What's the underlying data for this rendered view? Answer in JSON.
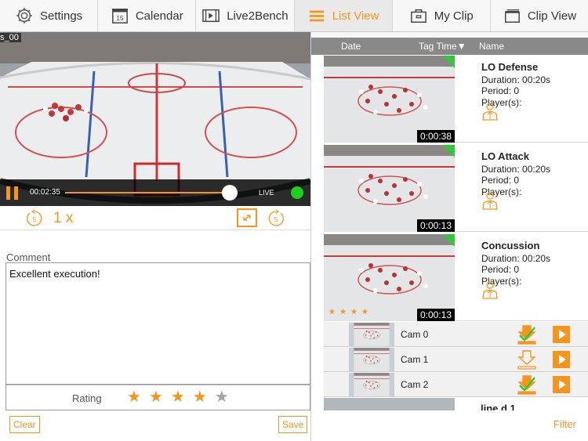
{
  "tabs": [
    {
      "label": "Settings",
      "icon": "gear-icon"
    },
    {
      "label": "Calendar",
      "icon": "calendar-icon",
      "icon_text": "15"
    },
    {
      "label": "Live2Bench",
      "icon": "film-strip-icon"
    },
    {
      "label": "List View",
      "icon": "list-icon",
      "active": true
    },
    {
      "label": "My Clip",
      "icon": "briefcase-icon"
    },
    {
      "label": "Clip View",
      "icon": "stacked-screens-icon"
    }
  ],
  "video": {
    "source_label": "s_00",
    "time": "00:02:35",
    "progress_fraction": 0.955,
    "live_label": "LIVE",
    "live_status_color": "#1ed01e"
  },
  "playback": {
    "rewind_seconds": "5",
    "speed": "1 x",
    "forward_seconds": "5"
  },
  "comment": {
    "label": "Comment",
    "text": "Excellent execution!"
  },
  "rating": {
    "label": "Rating",
    "value": 4,
    "max": 5
  },
  "buttons": {
    "clear": "Clear",
    "save": "Save",
    "filter": "Filter"
  },
  "list_header": {
    "date": "Date",
    "tag_time": "Tag Time",
    "sort_indicator": "▼",
    "name": "Name"
  },
  "clips": [
    {
      "name": "LO Defense",
      "duration": "Duration: 00:20s",
      "period": "Period: 0",
      "players": "Player(s):",
      "timestamp": "0:00:38",
      "stars": 0
    },
    {
      "name": "LO Attack",
      "duration": "Duration: 00:20s",
      "period": "Period: 0",
      "players": "Player(s):",
      "timestamp": "0:00:13",
      "stars": 0
    },
    {
      "name": "Concussion",
      "duration": "Duration: 00:20s",
      "period": "Period: 0",
      "players": "Player(s):",
      "timestamp": "0:00:13",
      "stars": 4
    }
  ],
  "cameras": [
    {
      "label": "Cam 0",
      "downloaded": true
    },
    {
      "label": "Cam 1",
      "downloaded": false
    },
    {
      "label": "Cam 2",
      "downloaded": true
    }
  ],
  "partial_clip": {
    "name": "line d 1"
  },
  "colors": {
    "accent": "#f7941d",
    "header_gray": "#898989",
    "tag_green": "#31c93a"
  }
}
